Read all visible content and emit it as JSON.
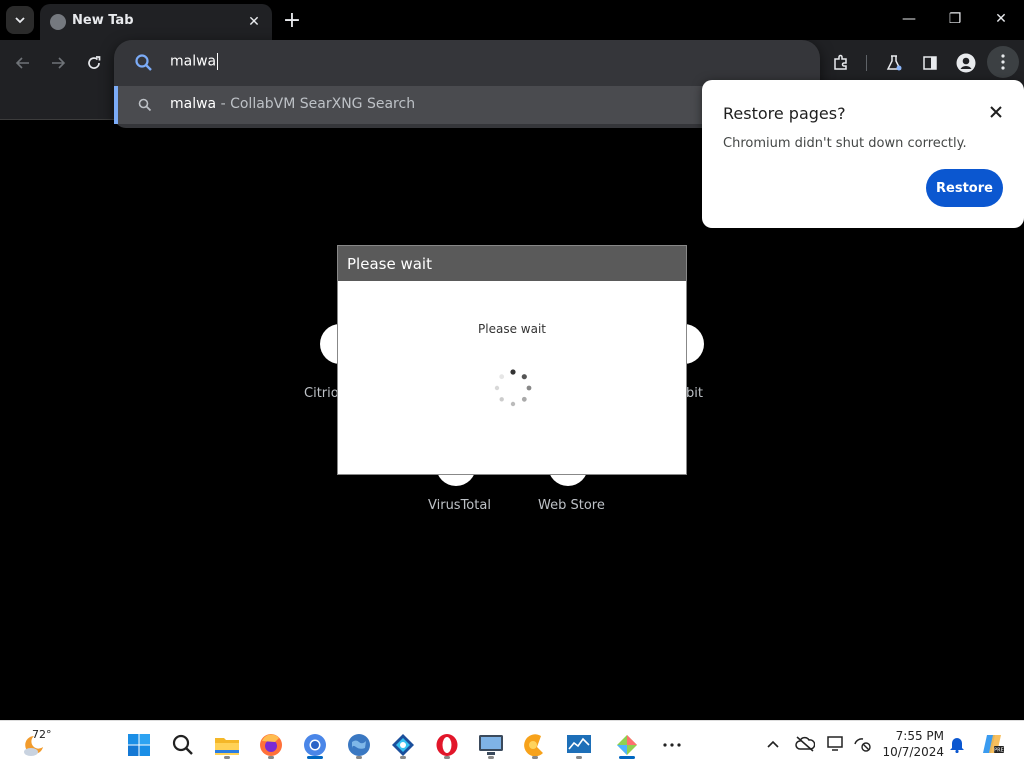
{
  "browser": {
    "tab": {
      "title": "New Tab",
      "close": "✕"
    },
    "new_tab": "+",
    "window": {
      "minimize": "—",
      "restore": "❐",
      "close": "✕"
    }
  },
  "omnibox": {
    "value": "malwa",
    "suggestion": {
      "query": "malwa",
      "suffix": " - CollabVM SearXNG Search"
    }
  },
  "ntp": {
    "shortcuts": [
      {
        "label": "Citrio"
      },
      {
        "label": "bit"
      },
      {
        "label": "VirusTotal"
      },
      {
        "label": "Web Store"
      }
    ]
  },
  "restore_popup": {
    "title": "Restore pages?",
    "message": "Chromium didn't shut down correctly.",
    "button": "Restore"
  },
  "wait_dialog": {
    "title": "Please wait",
    "message": "Please wait"
  },
  "taskbar": {
    "weather_temp": "72°",
    "apps": [
      "start",
      "search",
      "file-explorer",
      "firefox",
      "chromium",
      "globe-browser",
      "edge-dev",
      "opera",
      "remote-desktop",
      "citrio",
      "monitor",
      "fences",
      "more"
    ],
    "time": "7:55 PM",
    "date": "10/7/2024"
  },
  "colors": {
    "accent_blue": "#0b57d0",
    "omnibox_bg": "#35363a",
    "suggestion_bg": "#4a4b4f",
    "wait_header": "#5a5a5a"
  }
}
